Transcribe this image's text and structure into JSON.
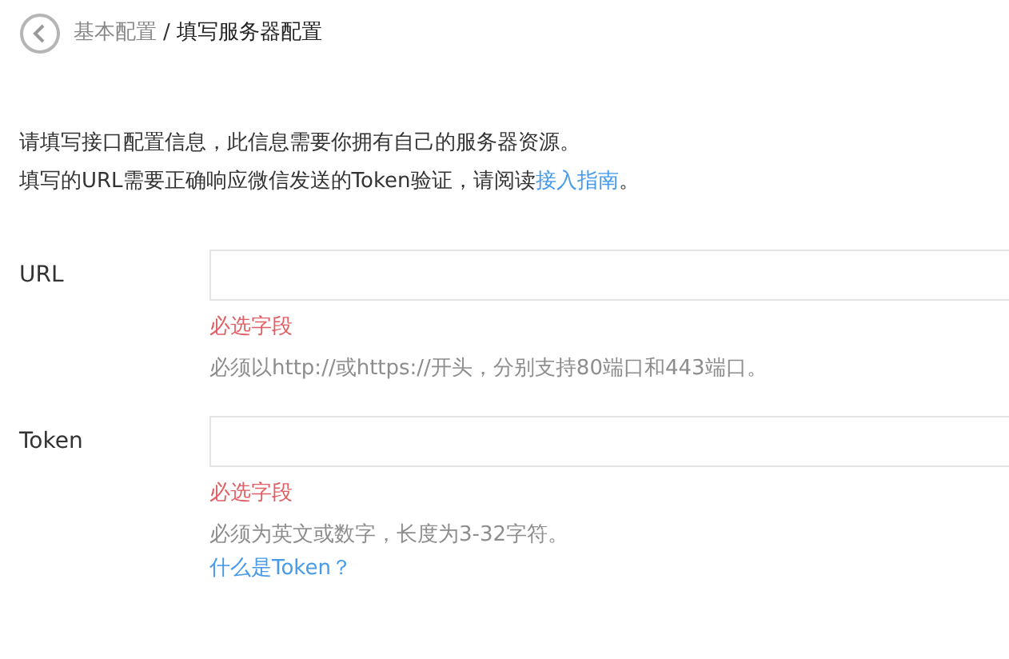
{
  "breadcrumb": {
    "parent": "基本配置",
    "separator": "/",
    "current": "填写服务器配置"
  },
  "intro": [
    {
      "text": "请填写接口配置信息，此信息需要你拥有自己的服务器资源。"
    },
    {
      "text": "填写的URL需要正确响应微信发送的Token验证，请阅读",
      "link": "接入指南",
      "after": "。"
    }
  ],
  "fields": [
    {
      "label": "URL",
      "error": "必选字段",
      "hint": "必须以http://或https://开头，分别支持80端口和443端口。"
    },
    {
      "label": "Token",
      "error": "必选字段",
      "hint": "必须为英文或数字，长度为3-32字符。",
      "link": "什么是Token？"
    }
  ]
}
